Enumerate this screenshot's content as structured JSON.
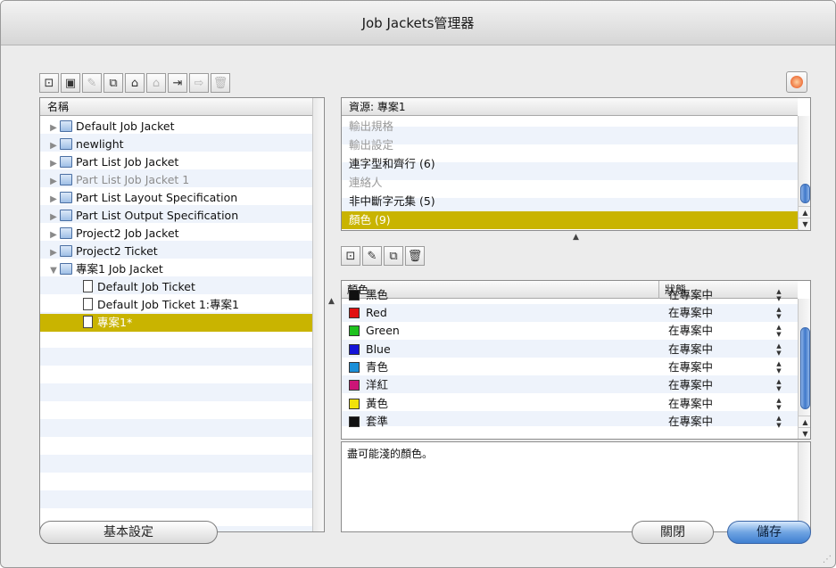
{
  "window": {
    "title": "Job Jackets管理器"
  },
  "left_toolbar": {
    "buttons": [
      {
        "icon": "new-job-jacket-icon",
        "glyph": "⊡",
        "dim": false
      },
      {
        "icon": "new-job-ticket-icon",
        "glyph": "▣",
        "dim": false
      },
      {
        "icon": "edit-icon",
        "glyph": "✎",
        "dim": true
      },
      {
        "icon": "duplicate-icon",
        "glyph": "⧉",
        "dim": false
      },
      {
        "icon": "open-folder-icon",
        "glyph": "⌂",
        "dim": false
      },
      {
        "icon": "save-folder-icon",
        "glyph": "⌂",
        "dim": true
      },
      {
        "icon": "import-icon",
        "glyph": "⇥",
        "dim": false
      },
      {
        "icon": "export-icon",
        "glyph": "⇨",
        "dim": true
      },
      {
        "icon": "delete-icon",
        "glyph": "🗑",
        "dim": true
      }
    ]
  },
  "tree": {
    "header": "名稱",
    "items": [
      {
        "label": "Default Job Jacket",
        "toggle": "▶",
        "kind": "folder",
        "indent": 0,
        "selected": false,
        "dim": false
      },
      {
        "label": "newlight",
        "toggle": "▶",
        "kind": "folder",
        "indent": 0,
        "selected": false,
        "dim": false
      },
      {
        "label": "Part List Job Jacket",
        "toggle": "▶",
        "kind": "folder",
        "indent": 0,
        "selected": false,
        "dim": false
      },
      {
        "label": "Part List Job Jacket 1",
        "toggle": "▶",
        "kind": "folder",
        "indent": 0,
        "selected": false,
        "dim": true
      },
      {
        "label": "Part List Layout Specification",
        "toggle": "▶",
        "kind": "folder",
        "indent": 0,
        "selected": false,
        "dim": false
      },
      {
        "label": "Part List Output Specification",
        "toggle": "▶",
        "kind": "folder",
        "indent": 0,
        "selected": false,
        "dim": false
      },
      {
        "label": "Project2 Job Jacket",
        "toggle": "▶",
        "kind": "folder",
        "indent": 0,
        "selected": false,
        "dim": false
      },
      {
        "label": "Project2 Ticket",
        "toggle": "▶",
        "kind": "folder",
        "indent": 0,
        "selected": false,
        "dim": false
      },
      {
        "label": "專案1 Job Jacket",
        "toggle": "▼",
        "kind": "folder",
        "indent": 0,
        "selected": false,
        "dim": false
      },
      {
        "label": "Default Job Ticket",
        "toggle": "",
        "kind": "doc",
        "indent": 1,
        "selected": false,
        "dim": false
      },
      {
        "label": "Default Job Ticket 1:專案1",
        "toggle": "",
        "kind": "doc",
        "indent": 1,
        "selected": false,
        "dim": false
      },
      {
        "label": "專案1*",
        "toggle": "",
        "kind": "doc",
        "indent": 1,
        "selected": true,
        "dim": false
      }
    ]
  },
  "resources": {
    "header": "資源: 專案1",
    "items": [
      {
        "label": "輸出規格",
        "dim": true,
        "selected": false
      },
      {
        "label": "輸出設定",
        "dim": true,
        "selected": false
      },
      {
        "label": "連字型和齊行 (6)",
        "dim": false,
        "selected": false
      },
      {
        "label": "連絡人",
        "dim": true,
        "selected": false
      },
      {
        "label": "非中斷字元集 (5)",
        "dim": false,
        "selected": false
      },
      {
        "label": "顏色 (9)",
        "dim": false,
        "selected": true
      }
    ]
  },
  "mid_toolbar": {
    "buttons": [
      {
        "icon": "new-icon",
        "glyph": "⊡",
        "dim": false
      },
      {
        "icon": "edit-icon",
        "glyph": "✎",
        "dim": false
      },
      {
        "icon": "duplicate-icon",
        "glyph": "⧉",
        "dim": false
      },
      {
        "icon": "delete-icon",
        "glyph": "🗑",
        "dim": false
      }
    ]
  },
  "colors": {
    "col_name": "顏色",
    "col_status": "狀態",
    "partial_row": {
      "name": "黑色",
      "status": "在專案中",
      "color": "#111111"
    },
    "rows": [
      {
        "name": "Red",
        "status": "在專案中",
        "color": "#e01010"
      },
      {
        "name": "Green",
        "status": "在專案中",
        "color": "#1ec21e"
      },
      {
        "name": "Blue",
        "status": "在專案中",
        "color": "#1414d8"
      },
      {
        "name": "青色",
        "status": "在專案中",
        "color": "#1a8fd8"
      },
      {
        "name": "洋紅",
        "status": "在專案中",
        "color": "#cc1477"
      },
      {
        "name": "黃色",
        "status": "在專案中",
        "color": "#f2e20a"
      },
      {
        "name": "套準",
        "status": "在專案中",
        "color": "#111111"
      }
    ]
  },
  "description": "盡可能淺的顏色。",
  "buttons": {
    "preferences": "基本設定",
    "close": "關閉",
    "save": "儲存"
  },
  "accent": {
    "selection": "#c9b400",
    "stripe": "#eef3fb"
  }
}
